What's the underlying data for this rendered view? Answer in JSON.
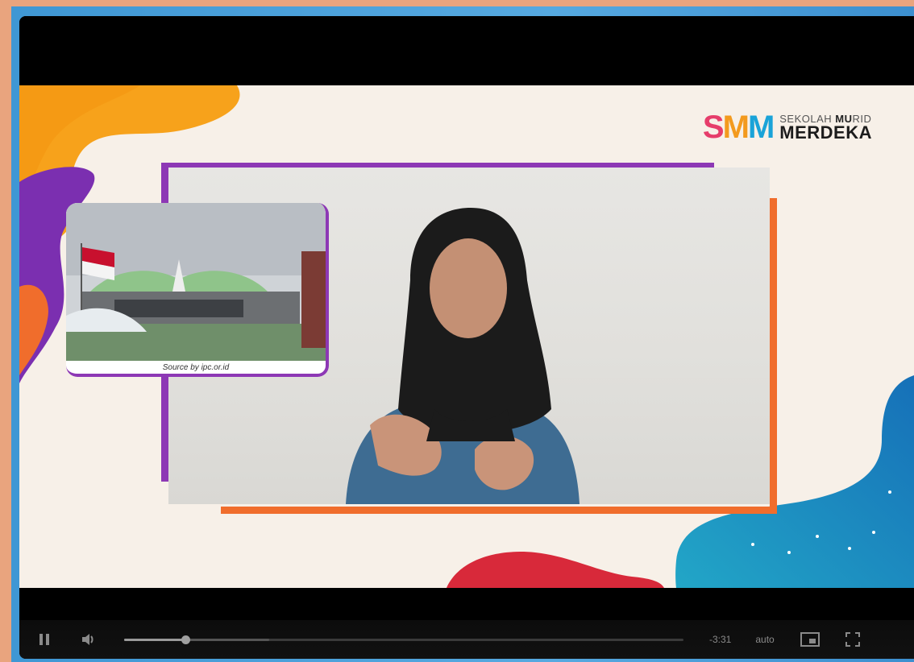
{
  "logo": {
    "mark_letters": [
      "S",
      "M",
      "M"
    ],
    "line1_plain": "SEKOLAH ",
    "line1_bold": "MU",
    "line1_rest": "RID",
    "line2": "MERDEKA"
  },
  "inset": {
    "caption": "Source by ipc.or.id"
  },
  "controls": {
    "pause_icon": "pause-icon",
    "volume_icon": "volume-icon",
    "progress": 0.11,
    "buffered": 0.26,
    "time_remaining": "-3:31",
    "quality": "auto",
    "pip_icon": "picture-in-picture-icon",
    "fullscreen_icon": "fullscreen-icon"
  },
  "colors": {
    "purple": "#8d38b5",
    "orange": "#f06d2c",
    "red": "#d8293a",
    "blue": "#1a7fc1",
    "yellow": "#f7a21b"
  }
}
